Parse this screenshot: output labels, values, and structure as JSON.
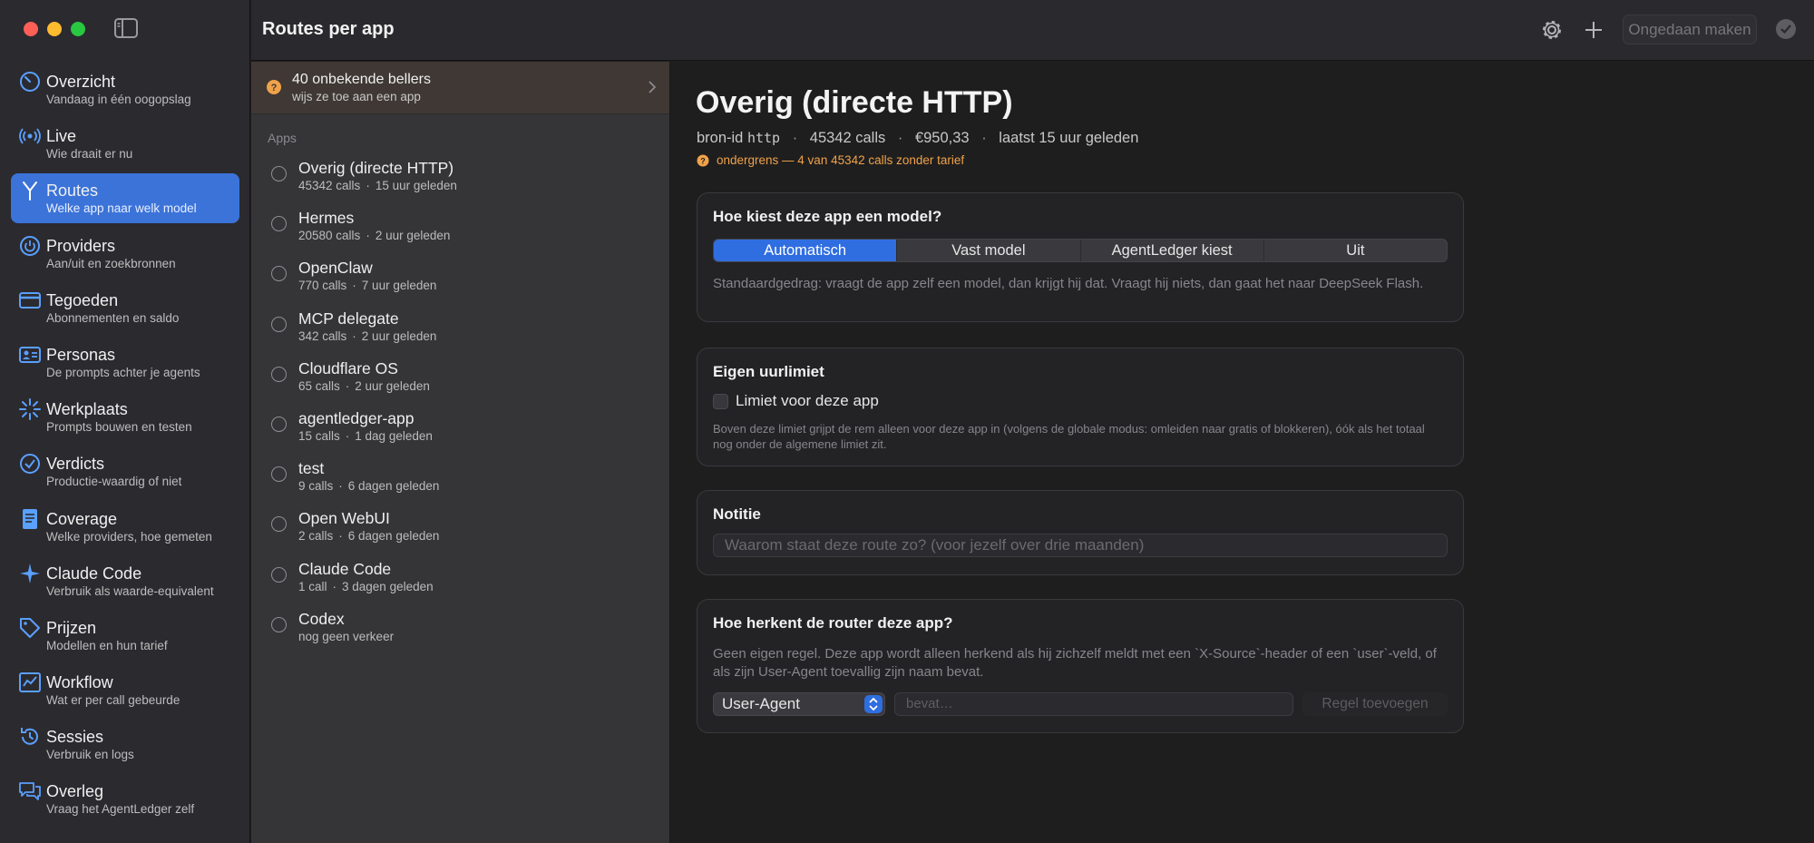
{
  "toolbar": {
    "title": "Routes per app",
    "undo_label": "Ongedaan maken"
  },
  "sidebar": {
    "items": [
      {
        "label": "Overzicht",
        "sub": "Vandaag in één oogopslag",
        "icon": "gauge-icon"
      },
      {
        "label": "Live",
        "sub": "Wie draait er nu",
        "icon": "broadcast-icon"
      },
      {
        "label": "Routes",
        "sub": "Welke app naar welk model",
        "icon": "route-split-icon"
      },
      {
        "label": "Providers",
        "sub": "Aan/uit en zoekbronnen",
        "icon": "power-icon"
      },
      {
        "label": "Tegoeden",
        "sub": "Abonnementen en saldo",
        "icon": "credit-card-icon"
      },
      {
        "label": "Personas",
        "sub": "De prompts achter je agents",
        "icon": "person-card-icon"
      },
      {
        "label": "Werkplaats",
        "sub": "Prompts bouwen en testen",
        "icon": "sparkle-icon"
      },
      {
        "label": "Verdicts",
        "sub": "Productie-waardig of niet",
        "icon": "checkmark-circle-icon"
      },
      {
        "label": "Coverage",
        "sub": "Welke providers, hoe gemeten",
        "icon": "document-icon"
      },
      {
        "label": "Claude Code",
        "sub": "Verbruik als waarde-equivalent",
        "icon": "claude-spark-icon"
      },
      {
        "label": "Prijzen",
        "sub": "Modellen en hun tarief",
        "icon": "tag-icon"
      },
      {
        "label": "Workflow",
        "sub": "Wat er per call gebeurde",
        "icon": "chart-icon"
      },
      {
        "label": "Sessies",
        "sub": "Verbruik en logs",
        "icon": "history-icon"
      },
      {
        "label": "Overleg",
        "sub": "Vraag het AgentLedger zelf",
        "icon": "chat-bubbles-icon"
      }
    ]
  },
  "banner": {
    "title": "40 onbekende bellers",
    "sub": "wijs ze toe aan een app"
  },
  "list": {
    "header": "Apps",
    "apps": [
      {
        "name": "Overig (directe HTTP)",
        "calls": "45342 calls",
        "when": "15 uur geleden"
      },
      {
        "name": "Hermes",
        "calls": "20580 calls",
        "when": "2 uur geleden"
      },
      {
        "name": "OpenClaw",
        "calls": "770 calls",
        "when": "7 uur geleden"
      },
      {
        "name": "MCP delegate",
        "calls": "342 calls",
        "when": "2 uur geleden"
      },
      {
        "name": "Cloudflare OS",
        "calls": "65 calls",
        "when": "2 uur geleden"
      },
      {
        "name": "agentledger-app",
        "calls": "15 calls",
        "when": "1 dag geleden"
      },
      {
        "name": "test",
        "calls": "9 calls",
        "when": "6 dagen geleden"
      },
      {
        "name": "Open WebUI",
        "calls": "2 calls",
        "when": "6 dagen geleden"
      },
      {
        "name": "Claude Code",
        "calls": "1 call",
        "when": "3 dagen geleden"
      },
      {
        "name": "Codex",
        "calls": "nog geen verkeer",
        "when": ""
      }
    ]
  },
  "detail": {
    "title": "Overig (directe HTTP)",
    "source_label": "bron-id",
    "source_id": "http",
    "calls": "45342 calls",
    "cost": "€950,33",
    "last": "laatst 15 uur geleden",
    "warning": "ondergrens — 4 van 45342 calls zonder tarief",
    "model_card": {
      "title": "Hoe kiest deze app een model?",
      "options": [
        "Automatisch",
        "Vast model",
        "AgentLedger kiest",
        "Uit"
      ],
      "selected": "Automatisch",
      "help": "Standaardgedrag: vraagt de app zelf een model, dan krijgt hij dat. Vraagt hij niets, dan gaat het naar DeepSeek Flash."
    },
    "limit_card": {
      "title": "Eigen uurlimiet",
      "checkbox_label": "Limiet voor deze app",
      "help": "Boven deze limiet grijpt de rem alleen voor deze app in (volgens de globale modus: omleiden naar gratis of blokkeren), óók als het totaal nog onder de algemene limiet zit."
    },
    "note_card": {
      "title": "Notitie",
      "placeholder": "Waarom staat deze route zo? (voor jezelf over drie maanden)"
    },
    "router_card": {
      "title": "Hoe herkent de router deze app?",
      "help": "Geen eigen regel. Deze app wordt alleen herkend als hij zichzelf meldt met een `X-Source`-header of een `user`-veld, of als zijn User-Agent toevallig zijn naam bevat.",
      "select_value": "User-Agent",
      "input_placeholder": "bevat…",
      "add_label": "Regel toevoegen"
    }
  },
  "colors": {
    "accent": "#3b73d9",
    "warning": "#f0a24a",
    "sidebar_bg": "#2b2a2f"
  }
}
